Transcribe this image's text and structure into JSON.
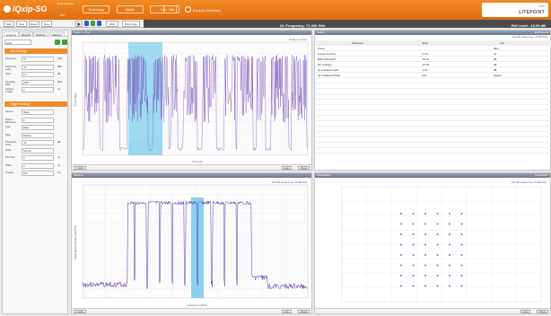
{
  "app": {
    "logo_text": "IQxip-SG",
    "ip_header": "Host Address",
    "ip_value": "192"
  },
  "top_tabs": [
    "Technology",
    "Admin",
    "Tools",
    "File"
  ],
  "error_label": "Error(s) Detected",
  "brand": {
    "line1": "VIAVI",
    "line2": "LITEPOINT"
  },
  "status": {
    "frequency": "UL Frequency: 71.000 GHz",
    "ref_level": "Ref Level: -10.00 dB"
  },
  "toolbar": {
    "btn1": "Start",
    "btn2": "Stop",
    "btn3": "Reset",
    "btn4": "Save",
    "dropdown": "0001",
    "dropdown2": "BCH Note"
  },
  "sidebar": {
    "tabs": [
      "Analysis",
      "Results",
      "Settings",
      "Markers"
    ],
    "mode_value": "Input",
    "section1": "VSA Settings",
    "rows1": [
      {
        "label": "Frequency",
        "value": "70",
        "unit": "GHz"
      },
      {
        "label": "Reference Level",
        "value": "-10",
        "unit": "dBm"
      },
      {
        "label": "Span",
        "value": "1.2",
        "unit": "dB"
      },
      {
        "label": "Sampling Rate",
        "value": "2000",
        "unit": "MHz"
      },
      {
        "label": "Capture Length",
        "value": "3",
        "unit": "ms"
      }
    ],
    "section2": "Trigger Settings",
    "rows2": [
      {
        "label": "Source",
        "value": "Video",
        "unit": ""
      },
      {
        "label": "Marker Reference",
        "value": "1",
        "unit": ""
      },
      {
        "label": "Type",
        "value": "Edge",
        "unit": ""
      },
      {
        "label": "Edge",
        "value": "Positive",
        "unit": ""
      },
      {
        "label": "Threshold Level",
        "value": "-20",
        "unit": "dB"
      },
      {
        "label": "Mode",
        "value": "Normal",
        "unit": ""
      },
      {
        "label": "Pre-Time",
        "value": "0",
        "unit": "us"
      },
      {
        "label": "Offset",
        "value": "0",
        "unit": "us"
      },
      {
        "label": "Timeout",
        "value": "100",
        "unit": "ms"
      }
    ]
  },
  "panels": {
    "power_vs_time": {
      "header": "Power vs. Time",
      "title": "Power vs Time",
      "ylabel": "Power (dBm)",
      "xlabel": "Time (us)",
      "btn_hold": "1 Hold",
      "btn_auto": "Auto",
      "btn_reset": "Reset"
    },
    "results": {
      "header": "Results",
      "corner": "EVM Results",
      "sub": "CC1 RF Center Freq: 70.000 GHz",
      "columns": [
        "Parameter",
        "Value",
        "Unit"
      ],
      "rows": [
        [
          "Power",
          "",
          "dBm"
        ],
        [
          "Frequency Error",
          "17.12",
          "Hz"
        ],
        [
          "RMS Data EVM",
          "-32.02",
          "dB"
        ],
        [
          "DC Leakage",
          "-20.33",
          "dB"
        ],
        [
          "IQ Imbalance Gain",
          "-0.02",
          "dB"
        ],
        [
          "IQ Imbalance Phase",
          "0.02",
          "degree"
        ]
      ]
    },
    "spectrum": {
      "header": "Spectrum",
      "sub": "CC1 RF Center Freq: 70.000 GHz",
      "ylabel": "Power Spectral Density (dBm/MHz)",
      "xlabel": "Frequency (MHz)",
      "btn_hold": "1 Hold",
      "btn_auto": "Auto",
      "btn_reset": "Reset"
    },
    "constellation": {
      "header": "Constellation",
      "corner": "Constellation",
      "sub": "CC1 RF Center Freq: 70.000 GHz",
      "btn_auto": "Auto",
      "btn_reset": "Reset"
    }
  }
}
